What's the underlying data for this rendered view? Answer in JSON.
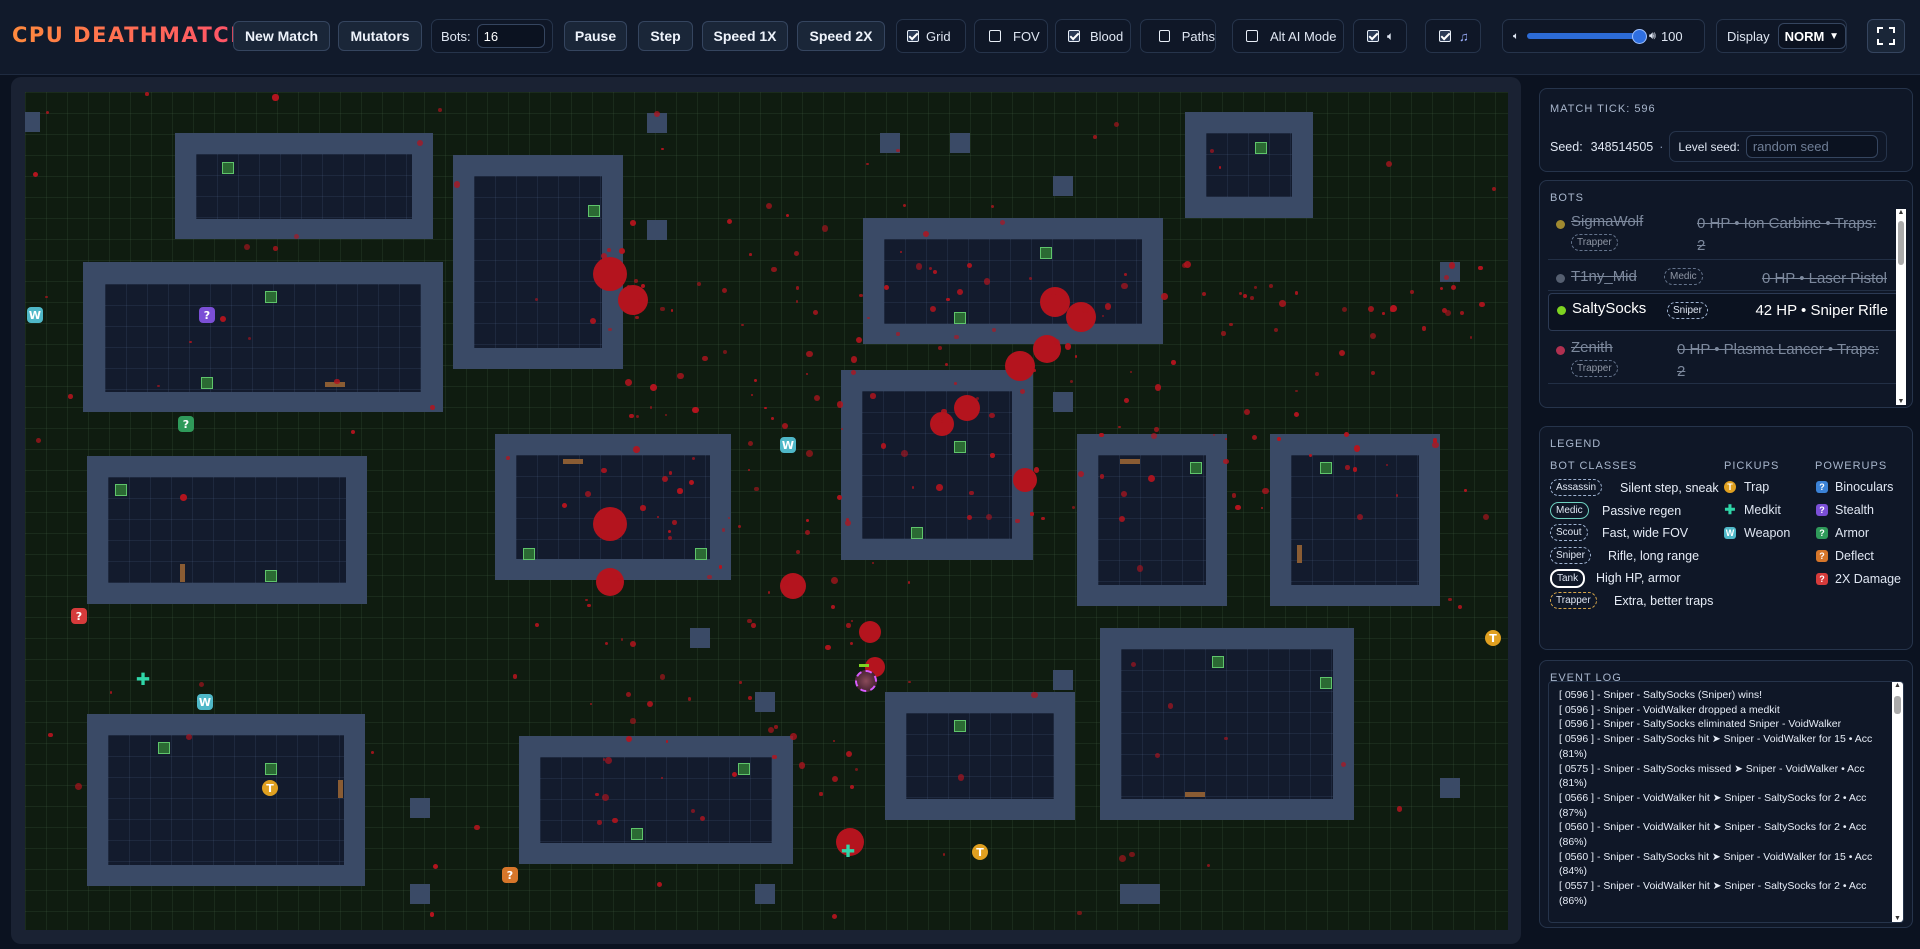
{
  "app": {
    "title": "CPU DEATHMATCH!"
  },
  "toolbar": {
    "new_match": "New Match",
    "mutators": "Mutators",
    "bots_label": "Bots:",
    "bots_value": "16",
    "pause": "Pause",
    "step": "Step",
    "speed1": "Speed 1X",
    "speed2": "Speed 2X",
    "toggles": [
      {
        "label": "Grid",
        "checked": true
      },
      {
        "label": "FOV",
        "checked": false
      },
      {
        "label": "Blood",
        "checked": true
      },
      {
        "label": "Paths",
        "checked": false
      },
      {
        "label": "Alt AI Mode",
        "checked": false
      }
    ],
    "sound_checked": true,
    "music_checked": true,
    "volume": 100,
    "volume_label": "100",
    "display_label": "Display",
    "display_value": "NORM"
  },
  "info": {
    "tick_label": "MATCH TICK: 596",
    "seed_label": "Seed:",
    "seed_value": "348514505",
    "seed_sep": "·",
    "level_seed_label": "Level seed:",
    "level_seed_placeholder": "random seed"
  },
  "bots": {
    "title": "BOTS",
    "items": [
      {
        "name": "SigmaWolf",
        "class": "Trapper",
        "stats": "0 HP • Ion Carbine • Traps: 2",
        "dead": true,
        "dot": "#a08a30"
      },
      {
        "name": "T1ny_Mid",
        "class": "Medic",
        "stats": "0 HP • Laser Pistol",
        "dead": true,
        "dot": "#555f70"
      },
      {
        "name": "SaltySocks",
        "class": "Sniper",
        "stats": "42 HP • Sniper Rifle",
        "dead": false,
        "dot": "#7ed321"
      },
      {
        "name": "Zenith",
        "class": "Trapper",
        "stats": "0 HP • Plasma Lancer • Traps: 2",
        "dead": true,
        "dot": "#b03050"
      }
    ]
  },
  "legend": {
    "title": "LEGEND",
    "classes_title": "BOT CLASSES",
    "pickups_title": "PICKUPS",
    "powerups_title": "POWERUPS",
    "classes": [
      {
        "tag": "Assassin",
        "desc": "Silent step, sneak"
      },
      {
        "tag": "Medic",
        "desc": "Passive regen"
      },
      {
        "tag": "Scout",
        "desc": "Fast, wide FOV"
      },
      {
        "tag": "Sniper",
        "desc": "Rifle, long range"
      },
      {
        "tag": "Tank",
        "desc": "High HP, armor"
      },
      {
        "tag": "Trapper",
        "desc": "Extra, better traps"
      }
    ],
    "pickups": [
      {
        "label": "Trap",
        "icon": "T",
        "color": "#e0a020"
      },
      {
        "label": "Medkit",
        "icon": "✚",
        "color": "#2fd6a8"
      },
      {
        "label": "Weapon",
        "icon": "W",
        "color": "#4fb8c8"
      }
    ],
    "powerups": [
      {
        "label": "Binoculars",
        "color": "#3b82d6"
      },
      {
        "label": "Stealth",
        "color": "#7b4fd6"
      },
      {
        "label": "Armor",
        "color": "#2f9a5a"
      },
      {
        "label": "Deflect",
        "color": "#d6762a"
      },
      {
        "label": "2X Damage",
        "color": "#d63b3b"
      }
    ]
  },
  "event_log": {
    "title": "EVENT LOG",
    "lines": [
      "[ 0596 ] - Sniper - SaltySocks (Sniper) wins!",
      "[ 0596 ] - Sniper - VoidWalker dropped a medkit",
      "[ 0596 ] - Sniper - SaltySocks eliminated Sniper - VoidWalker",
      "[ 0596 ] - Sniper - SaltySocks hit ➤ Sniper - VoidWalker for 15 • Acc (81%)",
      "[ 0575 ] - Sniper - SaltySocks missed ➤ Sniper - VoidWalker • Acc (81%)",
      "[ 0566 ] - Sniper - VoidWalker hit ➤ Sniper - SaltySocks for 2 • Acc (87%)",
      "[ 0560 ] - Sniper - VoidWalker hit ➤ Sniper - SaltySocks for 2 • Acc (86%)",
      "[ 0560 ] - Sniper - SaltySocks hit ➤ Sniper - VoidWalker for 15 • Acc (84%)",
      "[ 0557 ] - Sniper - VoidWalker hit ➤ Sniper - SaltySocks for 2 • Acc (86%)"
    ]
  }
}
